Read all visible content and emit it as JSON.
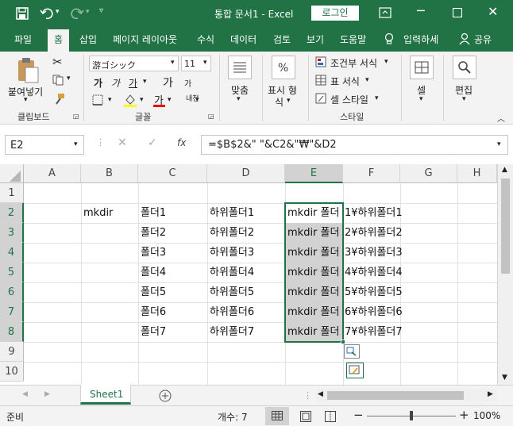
{
  "title": {
    "doc_title": "통합 문서1 - Excel",
    "login": "로그인"
  },
  "tabs": [
    "파일",
    "홈",
    "삽입",
    "페이지 레이아웃",
    "수식",
    "데이터",
    "검토",
    "보기",
    "도움말",
    "입력하세",
    "공유"
  ],
  "ribbon": {
    "clipboard": {
      "paste": "붙여넣기",
      "label": "클립보드"
    },
    "font": {
      "name": "游ゴシック",
      "size": "11",
      "label": "글꼴",
      "phonetic": "내천"
    },
    "alignment": {
      "label": "맞춤"
    },
    "number": {
      "label1": "표시 형",
      "label2": "식"
    },
    "styles": {
      "cond": "조건부 서식",
      "table": "표 서식",
      "cell": "셀 스타일",
      "label": "스타일"
    },
    "cells": {
      "label": "셀"
    },
    "editing": {
      "label": "편집"
    }
  },
  "formula_bar": {
    "name_box": "E2",
    "fx": "fx",
    "formula": "=$B$2&\" \"&C2&\"₩\"&D2"
  },
  "columns": [
    "A",
    "B",
    "C",
    "D",
    "E",
    "F",
    "G",
    "H"
  ],
  "rows": [
    "1",
    "2",
    "3",
    "4",
    "5",
    "6",
    "7",
    "8",
    "9",
    "10"
  ],
  "cells": {
    "B2": "mkdir",
    "C": [
      "폴더1",
      "폴더2",
      "폴더3",
      "폴더4",
      "폴더5",
      "폴더6",
      "폴더7"
    ],
    "D": [
      "하위폴더1",
      "하위폴더2",
      "하위폴더3",
      "하위폴더4",
      "하위폴더5",
      "하위폴더6",
      "하위폴더7"
    ],
    "E": [
      "mkdir 폴더",
      "mkdir 폴더",
      "mkdir 폴더",
      "mkdir 폴더",
      "mkdir 폴더",
      "mkdir 폴더",
      "mkdir 폴더"
    ],
    "F": [
      "1¥하위폴더1",
      "2¥하위폴더2",
      "3¥하위폴더3",
      "4¥하위폴더4",
      "5¥하위폴더5",
      "6¥하위폴더6",
      "7¥하위폴더7"
    ]
  },
  "sheet": {
    "tab": "Sheet1"
  },
  "status": {
    "ready": "준비",
    "count": "개수: 7",
    "zoom": "100%"
  },
  "colors": {
    "accent": "#217346",
    "selection": "#d2d2d2"
  }
}
